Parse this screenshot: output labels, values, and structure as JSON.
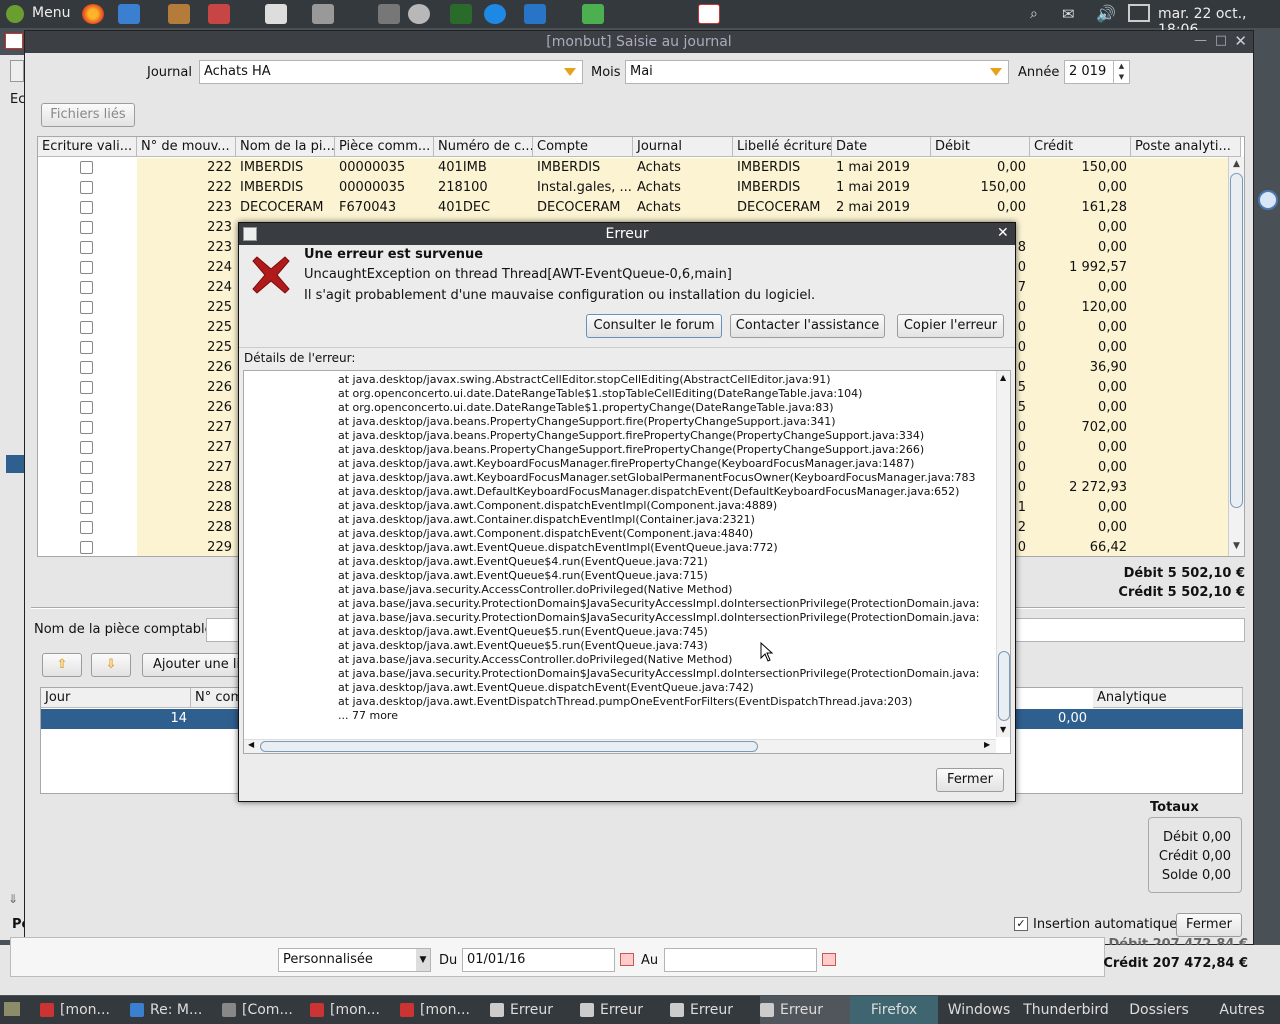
{
  "top_panel": {
    "menu_label": "Menu",
    "clock": "mar. 22 oct., 18:06"
  },
  "window": {
    "title": "[monbut] Saisie au journal"
  },
  "form": {
    "journal_label": "Journal",
    "journal_value": "Achats HA",
    "mois_label": "Mois",
    "mois_value": "Mai",
    "annee_label": "Année",
    "annee_value": "2 019",
    "fichiers_button": "Fichiers liés"
  },
  "table": {
    "headers": [
      "Ecriture vali...",
      "N° de mouv...",
      "Nom de la pi...",
      "Pièce comm...",
      "Numéro de c...",
      "Compte",
      "Journal",
      "Libellé écriture",
      "Date",
      "Débit",
      "Crédit",
      "Poste analyti..."
    ],
    "rows": [
      {
        "mouv": "222",
        "nom": "IMBERDIS",
        "piece": "00000035",
        "numero": "401IMB",
        "compte": "IMBERDIS",
        "journal": "Achats",
        "libelle": "IMBERDIS",
        "date": "1 mai 2019",
        "debit": "0,00",
        "credit": "150,00"
      },
      {
        "mouv": "222",
        "nom": "IMBERDIS",
        "piece": "00000035",
        "numero": "218100",
        "compte": "Instal.gales, ...",
        "journal": "Achats",
        "libelle": "IMBERDIS",
        "date": "1 mai 2019",
        "debit": "150,00",
        "credit": "0,00"
      },
      {
        "mouv": "223",
        "nom": "DECOCERAM",
        "piece": "F670043",
        "numero": "401DEC",
        "compte": "DECOCERAM",
        "journal": "Achats",
        "libelle": "DECOCERAM",
        "date": "2 mai 2019",
        "debit": "0,00",
        "credit": "161,28"
      },
      {
        "mouv": "223",
        "credit": "0,00"
      },
      {
        "mouv": "223",
        "debit": "8",
        "credit": "0,00"
      },
      {
        "mouv": "224",
        "debit": "0",
        "credit": "1 992,57"
      },
      {
        "mouv": "224",
        "debit": "7",
        "credit": "0,00"
      },
      {
        "mouv": "225",
        "debit": "0",
        "credit": "120,00"
      },
      {
        "mouv": "225",
        "debit": "0",
        "credit": "0,00"
      },
      {
        "mouv": "225",
        "debit": "0",
        "credit": "0,00"
      },
      {
        "mouv": "226",
        "debit": "0",
        "credit": "36,90"
      },
      {
        "mouv": "226",
        "debit": "5",
        "credit": "0,00"
      },
      {
        "mouv": "226",
        "debit": "5",
        "credit": "0,00"
      },
      {
        "mouv": "227",
        "debit": "0",
        "credit": "702,00"
      },
      {
        "mouv": "227",
        "debit": "0",
        "credit": "0,00"
      },
      {
        "mouv": "227",
        "debit": "0",
        "credit": "0,00"
      },
      {
        "mouv": "228",
        "debit": "0",
        "credit": "2 272,93"
      },
      {
        "mouv": "228",
        "debit": "1",
        "credit": "0,00"
      },
      {
        "mouv": "228",
        "debit": "2",
        "credit": "0,00"
      },
      {
        "mouv": "229",
        "debit": "0",
        "credit": "66,42"
      }
    ]
  },
  "totals": {
    "debit": "Débit 5 502,10 €",
    "credit": "Crédit 5 502,10 €"
  },
  "lower": {
    "nom_piece_label": "Nom de la pièce comptable",
    "ajouter_button": "Ajouter une lig",
    "col_jour": "Jour",
    "col_ncom": "N° com",
    "col_analytique": "Analytique",
    "row_jour": "14",
    "row_credit": "0,00"
  },
  "totaux_box": {
    "title": "Totaux",
    "debit": "Débit 0,00",
    "credit": "Crédit 0,00",
    "solde": "Solde 0,00"
  },
  "insertion_label": "Insertion automatique",
  "fermer_main": "Fermer",
  "bottom": {
    "period": "Personnalisée",
    "du_label": "Du",
    "du_value": "01/01/16",
    "au_label": "Au",
    "credit_total": "Crédit 207 472,84 €",
    "debit_total_partial": "Débit 207 472,84 €",
    "po_label": "Po"
  },
  "dialog": {
    "title": "Erreur",
    "heading": "Une erreur est survenue",
    "line1": "UncaughtException on thread Thread[AWT-EventQueue-0,6,main]",
    "line2": "Il s'agit probablement d'une mauvaise configuration ou installation du logiciel.",
    "btn_forum": "Consulter le forum",
    "btn_assist": "Contacter l'assistance",
    "btn_copy": "Copier l'erreur",
    "details_label": "Détails de l'erreur:",
    "close": "Fermer",
    "trace": [
      "at java.desktop/javax.swing.AbstractCellEditor.stopCellEditing(AbstractCellEditor.java:91)",
      "at org.openconcerto.ui.date.DateRangeTable$1.stopTableCellEditing(DateRangeTable.java:104)",
      "at org.openconcerto.ui.date.DateRangeTable$1.propertyChange(DateRangeTable.java:83)",
      "at java.desktop/java.beans.PropertyChangeSupport.fire(PropertyChangeSupport.java:341)",
      "at java.desktop/java.beans.PropertyChangeSupport.firePropertyChange(PropertyChangeSupport.java:334)",
      "at java.desktop/java.beans.PropertyChangeSupport.firePropertyChange(PropertyChangeSupport.java:266)",
      "at java.desktop/java.awt.KeyboardFocusManager.firePropertyChange(KeyboardFocusManager.java:1487)",
      "at java.desktop/java.awt.KeyboardFocusManager.setGlobalPermanentFocusOwner(KeyboardFocusManager.java:783",
      "at java.desktop/java.awt.DefaultKeyboardFocusManager.dispatchEvent(DefaultKeyboardFocusManager.java:652)",
      "at java.desktop/java.awt.Component.dispatchEventImpl(Component.java:4889)",
      "at java.desktop/java.awt.Container.dispatchEventImpl(Container.java:2321)",
      "at java.desktop/java.awt.Component.dispatchEvent(Component.java:4840)",
      "at java.desktop/java.awt.EventQueue.dispatchEventImpl(EventQueue.java:772)",
      "at java.desktop/java.awt.EventQueue$4.run(EventQueue.java:721)",
      "at java.desktop/java.awt.EventQueue$4.run(EventQueue.java:715)",
      "at java.base/java.security.AccessController.doPrivileged(Native Method)",
      "at java.base/java.security.ProtectionDomain$JavaSecurityAccessImpl.doIntersectionPrivilege(ProtectionDomain.java:",
      "at java.base/java.security.ProtectionDomain$JavaSecurityAccessImpl.doIntersectionPrivilege(ProtectionDomain.java:",
      "at java.desktop/java.awt.EventQueue$5.run(EventQueue.java:745)",
      "at java.desktop/java.awt.EventQueue$5.run(EventQueue.java:743)",
      "at java.base/java.security.AccessController.doPrivileged(Native Method)",
      "at java.base/java.security.ProtectionDomain$JavaSecurityAccessImpl.doIntersectionPrivilege(ProtectionDomain.java:",
      "at java.desktop/java.awt.EventQueue.dispatchEvent(EventQueue.java:742)",
      "at java.desktop/java.awt.EventDispatchThread.pumpOneEventForFilters(EventDispatchThread.java:203)",
      "... 77 more"
    ]
  },
  "taskbar": {
    "items": [
      "[mon...",
      "Re: M...",
      "[Com...",
      "[mon...",
      "[mon...",
      "Erreur",
      "Erreur",
      "Erreur",
      "Erreur"
    ],
    "right": [
      "Firefox",
      "Windows",
      "Thunderbird",
      "Dossiers",
      "Autres"
    ]
  },
  "colors": {
    "row_highlight": "#fbf3d2",
    "selection": "#2f5f8f",
    "panel": "#34393d"
  }
}
